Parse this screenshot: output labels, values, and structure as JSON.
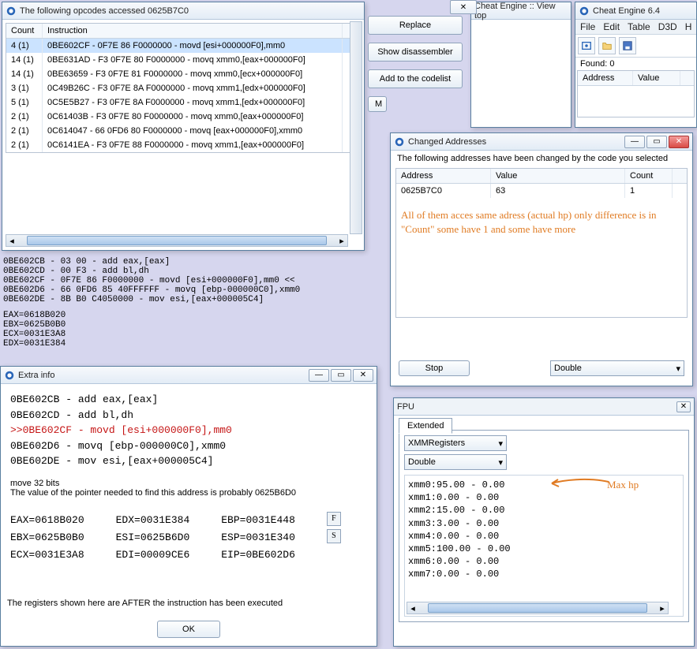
{
  "opcodes": {
    "title": "The following opcodes accessed 0625B7C0",
    "columns": {
      "count": "Count",
      "instruction": "Instruction"
    },
    "rows": [
      {
        "count": "4 (1)",
        "instr": "0BE602CF - 0F7E 86 F0000000  - movd [esi+000000F0],mm0"
      },
      {
        "count": "14 (1)",
        "instr": "0BE631AD - F3 0F7E 80 F0000000  - movq xmm0,[eax+000000F0]"
      },
      {
        "count": "14 (1)",
        "instr": "0BE63659 - F3 0F7E 81 F0000000  - movq xmm0,[ecx+000000F0]"
      },
      {
        "count": "3 (1)",
        "instr": "0C49B26C - F3 0F7E 8A F0000000  - movq xmm1,[edx+000000F0]"
      },
      {
        "count": "5 (1)",
        "instr": "0C5E5B27 - F3 0F7E 8A F0000000  - movq xmm1,[edx+000000F0]"
      },
      {
        "count": "2 (1)",
        "instr": "0C61403B - F3 0F7E 80 F0000000  - movq xmm0,[eax+000000F0]"
      },
      {
        "count": "2 (1)",
        "instr": "0C614047 - 66 0FD6 80 F0000000  - movq [eax+000000F0],xmm0"
      },
      {
        "count": "2 (1)",
        "instr": "0C6141EA - F3 0F7E 88 F0000000  - movq xmm1,[eax+000000F0]"
      }
    ],
    "buttons": {
      "replace": "Replace",
      "showdis": "Show disassembler",
      "addcode": "Add to the codelist"
    },
    "disasm_lines": [
      "0BE602CB - 03 00  - add eax,[eax]",
      "0BE602CD - 00 F3  - add bl,dh",
      "0BE602CF - 0F7E 86 F0000000  - movd [esi+000000F0],mm0 <<",
      "0BE602D6 - 66 0FD6 85 40FFFFFF  - movq [ebp-000000C0],xmm0",
      "0BE602DE - 8B B0 C4050000  - mov esi,[eax+000005C4]"
    ],
    "reg_summary": [
      "EAX=0618B020",
      "EBX=0625B0B0",
      "ECX=0031E3A8",
      "EDX=0031E384"
    ]
  },
  "extra": {
    "title": "Extra info",
    "code": [
      {
        "t": "0BE602CB - add eax,[eax]",
        "hl": false
      },
      {
        "t": "0BE602CD - add bl,dh",
        "hl": false
      },
      {
        "t": ">>0BE602CF - movd [esi+000000F0],mm0",
        "hl": true
      },
      {
        "t": "0BE602D6 - movq [ebp-000000C0],xmm0",
        "hl": false
      },
      {
        "t": "0BE602DE - mov esi,[eax+000005C4]",
        "hl": false
      }
    ],
    "note1": "move 32 bits",
    "note2": "The value of the pointer needed to find this address is probably 0625B6D0",
    "regs": [
      [
        "EAX=0618B020",
        "EDX=0031E384",
        "EBP=0031E448"
      ],
      [
        "EBX=0625B0B0",
        "ESI=0625B6D0",
        "ESP=0031E340"
      ],
      [
        "ECX=0031E3A8",
        "EDI=00009CE6",
        "EIP=0BE602D6"
      ]
    ],
    "f_label": "F",
    "s_label": "S",
    "footer": "The registers shown here are AFTER the instruction has been executed",
    "ok": "OK"
  },
  "changed": {
    "title": "Changed Addresses",
    "intro": "The following addresses have been changed by the code you selected",
    "columns": {
      "addr": "Address",
      "val": "Value",
      "count": "Count"
    },
    "rows": [
      {
        "addr": "0625B7C0",
        "val": "63",
        "count": "1"
      }
    ],
    "annotation": "All of them acces same adress (actual hp) only difference is in \"Count\" some have 1 and some have more",
    "stop": "Stop",
    "mode": "Double"
  },
  "fpu": {
    "label": "FPU",
    "tab": "Extended",
    "regset": "XMMRegisters",
    "fmt": "Double",
    "rows": [
      "xmm0:95.00 - 0.00",
      "xmm1:0.00 - 0.00",
      "xmm2:15.00 - 0.00",
      "xmm3:3.00 - 0.00",
      "xmm4:0.00 - 0.00",
      "xmm5:100.00 - 0.00",
      "xmm6:0.00 - 0.00",
      "xmm7:0.00 - 0.00"
    ],
    "annotation": "Max hp"
  },
  "cemain": {
    "title": "Cheat Engine 6.4",
    "menu": [
      "File",
      "Edit",
      "Table",
      "D3D",
      "H"
    ],
    "found_label": "Found:",
    "found_value": "0",
    "columns": {
      "addr": "Address",
      "val": "Value"
    }
  },
  "viewtop": {
    "title": "Cheat Engine :: View top"
  },
  "partial_btn": "M"
}
